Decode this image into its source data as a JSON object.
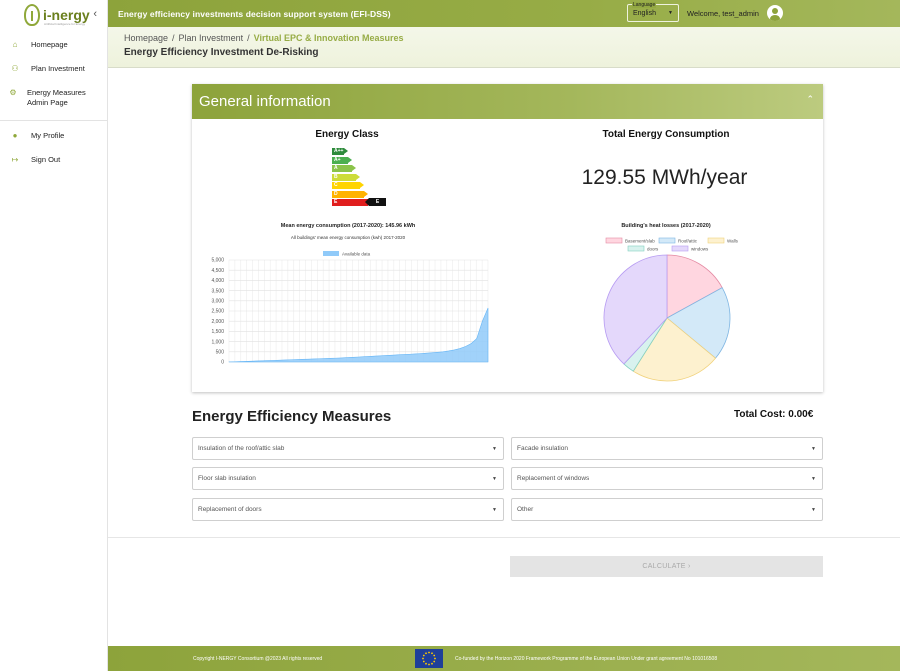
{
  "app": {
    "title": "Energy efficiency investments decision support system (EFI-DSS)",
    "brand": "i-nergy",
    "brand_tag": "Artificial Intelligence for Energy"
  },
  "language": {
    "caption": "Language",
    "value": "English"
  },
  "user": {
    "welcome": "Welcome, test_admin"
  },
  "sidebar": {
    "items": [
      {
        "label": "Homepage",
        "icon": "home-icon"
      },
      {
        "label": "Plan Investment",
        "icon": "users-icon"
      },
      {
        "label": "Energy Measures Admin Page",
        "icon": "gear-icon"
      },
      {
        "label": "My Profile",
        "icon": "profile-icon"
      },
      {
        "label": "Sign Out",
        "icon": "signout-icon"
      }
    ]
  },
  "breadcrumb": [
    "Homepage",
    "Plan Investment",
    "Virtual EPC & Innovation Measures"
  ],
  "page_title": "Energy Efficiency Investment De-Risking",
  "general": {
    "title": "General information",
    "energy_class_title": "Energy Class",
    "energy_class_levels": [
      {
        "label": "A++",
        "color": "#2e8b3c"
      },
      {
        "label": "A+",
        "color": "#4caf50"
      },
      {
        "label": "A",
        "color": "#8bc34a"
      },
      {
        "label": "B",
        "color": "#cddc39"
      },
      {
        "label": "C",
        "color": "#ffd400"
      },
      {
        "label": "D",
        "color": "#ffb300"
      },
      {
        "label": "E",
        "color": "#e01e1e"
      }
    ],
    "energy_class_value": "E",
    "consumption_title": "Total Energy Consumption",
    "consumption_value": "129.55 MWh/year"
  },
  "chart_data": [
    {
      "type": "area",
      "title": "Mean energy consumption (2017-2020): 145.96 kWh",
      "subtitle": "All buildings' mean energy consumption (kwh) 2017-2020",
      "series": [
        {
          "name": "Available data",
          "color": "#90caf9",
          "values": [
            5,
            10,
            20,
            30,
            40,
            50,
            60,
            70,
            80,
            90,
            100,
            110,
            120,
            130,
            140,
            150,
            160,
            170,
            180,
            190,
            200,
            215,
            230,
            245,
            260,
            275,
            290,
            305,
            320,
            335,
            350,
            365,
            380,
            395,
            410,
            430,
            450,
            475,
            500,
            540,
            590,
            660,
            760,
            900,
            1150,
            2000,
            2650
          ]
        }
      ],
      "yticks": [
        0,
        500,
        1000,
        1500,
        2000,
        2500,
        3000,
        3500,
        4000,
        4500,
        5000
      ],
      "ylim": [
        0,
        5000
      ],
      "grid": true,
      "legend": "top"
    },
    {
      "type": "pie",
      "title": "Building's heat losses (2017-2020)",
      "categories": [
        "Basement/slab",
        "Roof/attic",
        "Walls",
        "doors",
        "windows"
      ],
      "values": [
        17,
        19,
        23,
        3,
        38
      ],
      "colors": [
        "#ffd6e0",
        "#d3e9f8",
        "#fdf1cf",
        "#d8f2ee",
        "#e4d8fb"
      ],
      "borders": [
        "#e48aa3",
        "#7fb6e3",
        "#f1d27c",
        "#82d0c2",
        "#b79cf2"
      ],
      "legend": "top"
    }
  ],
  "measures": {
    "title": "Energy Efficiency Measures",
    "total_cost": "Total Cost: 0.00€",
    "selects": [
      "Insulation of the roof/attic slab",
      "Facade insulation",
      "Floor slab insulation",
      "Replacement of windows",
      "Replacement of doors",
      "Other"
    ],
    "calculate_label": "CALCULATE  ›"
  },
  "footer": {
    "copyright": "Copyright I-NERGY Consortium @2023 All rights reserved",
    "funding": "Co-funded by the Horizon 2020 Framework Programme of the European Union Under grant agreement No 101016508"
  }
}
